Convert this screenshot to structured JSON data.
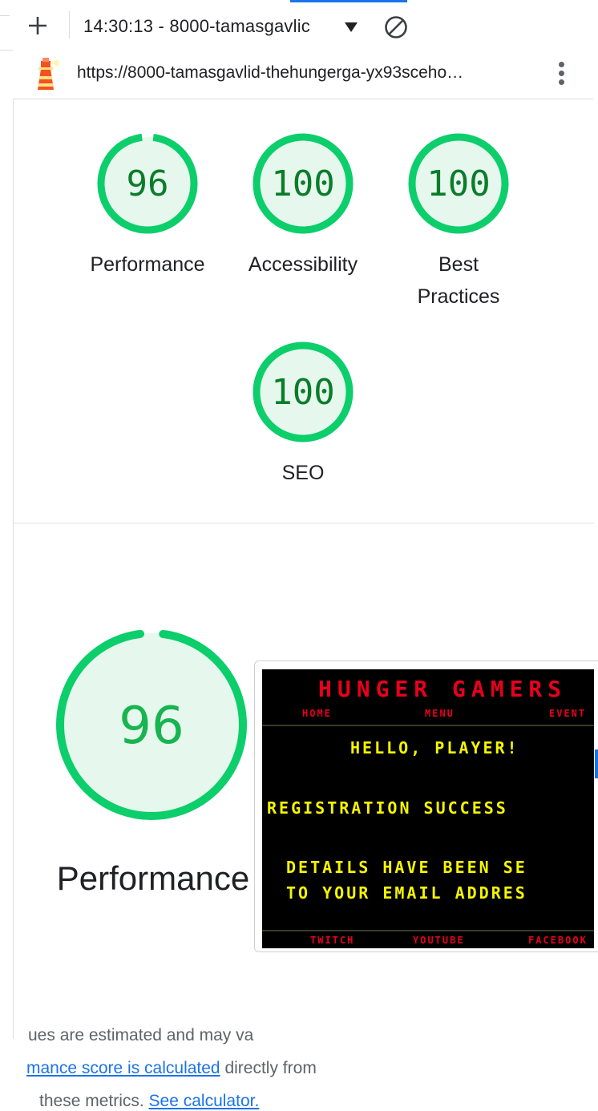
{
  "toolbar": {
    "report_select": "14:30:13 - 8000-tamasgavlic",
    "add_icon": "plus-icon",
    "clear_icon": "clear-icon"
  },
  "urlbar": {
    "url": "https://8000-tamasgavlid-thehungerga-yx93sceho…",
    "menu_icon": "more-vert-icon"
  },
  "scores": [
    {
      "value": "96",
      "label": "Performance",
      "fraction": 0.96
    },
    {
      "value": "100",
      "label": "Accessibility",
      "fraction": 1.0
    },
    {
      "value": "100",
      "label": "Best Practices",
      "fraction": 1.0
    },
    {
      "value": "100",
      "label": "SEO",
      "fraction": 1.0
    }
  ],
  "performance": {
    "score": "96",
    "label": "Performance",
    "fraction": 0.96,
    "estimated_text": "ues are estimated and may va",
    "calc_link": "mance score is calculated",
    "calc_rest": " directly from",
    "metrics_text": "these metrics. ",
    "calculator_link": "See calculator."
  },
  "screenshot": {
    "title": "HUNGER GAMERS",
    "nav": [
      "HOME",
      "MENU",
      "EVENT"
    ],
    "hello": "HELLO, PLAYER!",
    "registration": "REGISTRATION SUCCESS",
    "details_1": "DETAILS HAVE BEEN SE",
    "details_2": "TO YOUR EMAIL ADDRES",
    "footer": [
      "TWITCH",
      "YOUTUBE",
      "FACEBOOK"
    ]
  },
  "colors": {
    "pass_ring": "#0cce6b",
    "pass_fill": "#e6f7ed",
    "pass_text": "#0c7c2a",
    "link": "#1a73e8"
  }
}
